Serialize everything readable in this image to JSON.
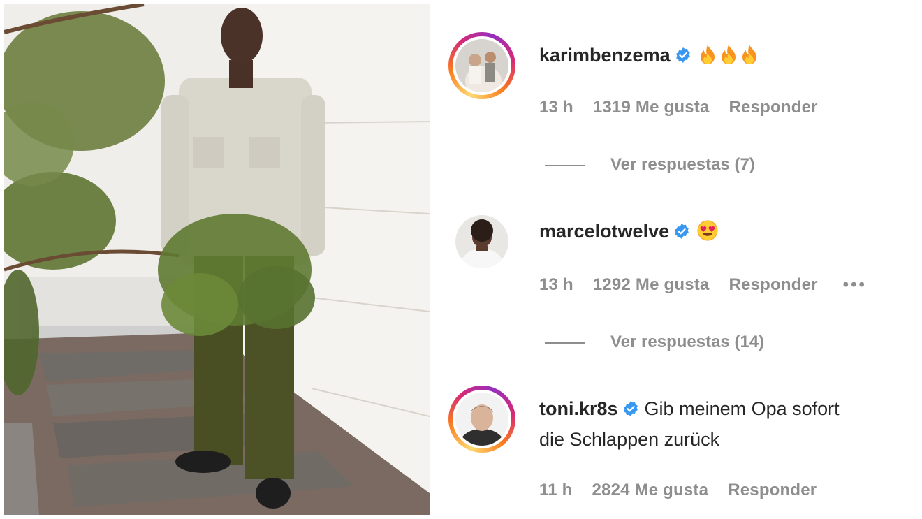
{
  "post_image": {
    "alt": ""
  },
  "comments": [
    {
      "username": "karimbenzema",
      "text": "",
      "emoji": [
        "fire-emoji",
        "fire-emoji",
        "fire-emoji"
      ],
      "time": "13 h",
      "likes": "1319 Me gusta",
      "reply": "Responder",
      "view_replies": "Ver respuestas (7)",
      "has_story_ring": true
    },
    {
      "username": "marcelotwelve",
      "text": "",
      "emoji": [
        "heart-eyes-emoji"
      ],
      "time": "13 h",
      "likes": "1292 Me gusta",
      "reply": "Responder",
      "more": "•••",
      "view_replies": "Ver respuestas (14)",
      "has_story_ring": false
    },
    {
      "username": "toni.kr8s",
      "text_line1": "Gib meinem Opa sofort",
      "text_line2": "die Schlappen zurück",
      "time": "11 h",
      "likes": "2824 Me gusta",
      "reply": "Responder",
      "has_story_ring": true
    }
  ],
  "colors": {
    "verified": "#3897f0",
    "meta": "#8e8e8e",
    "text": "#262626"
  }
}
